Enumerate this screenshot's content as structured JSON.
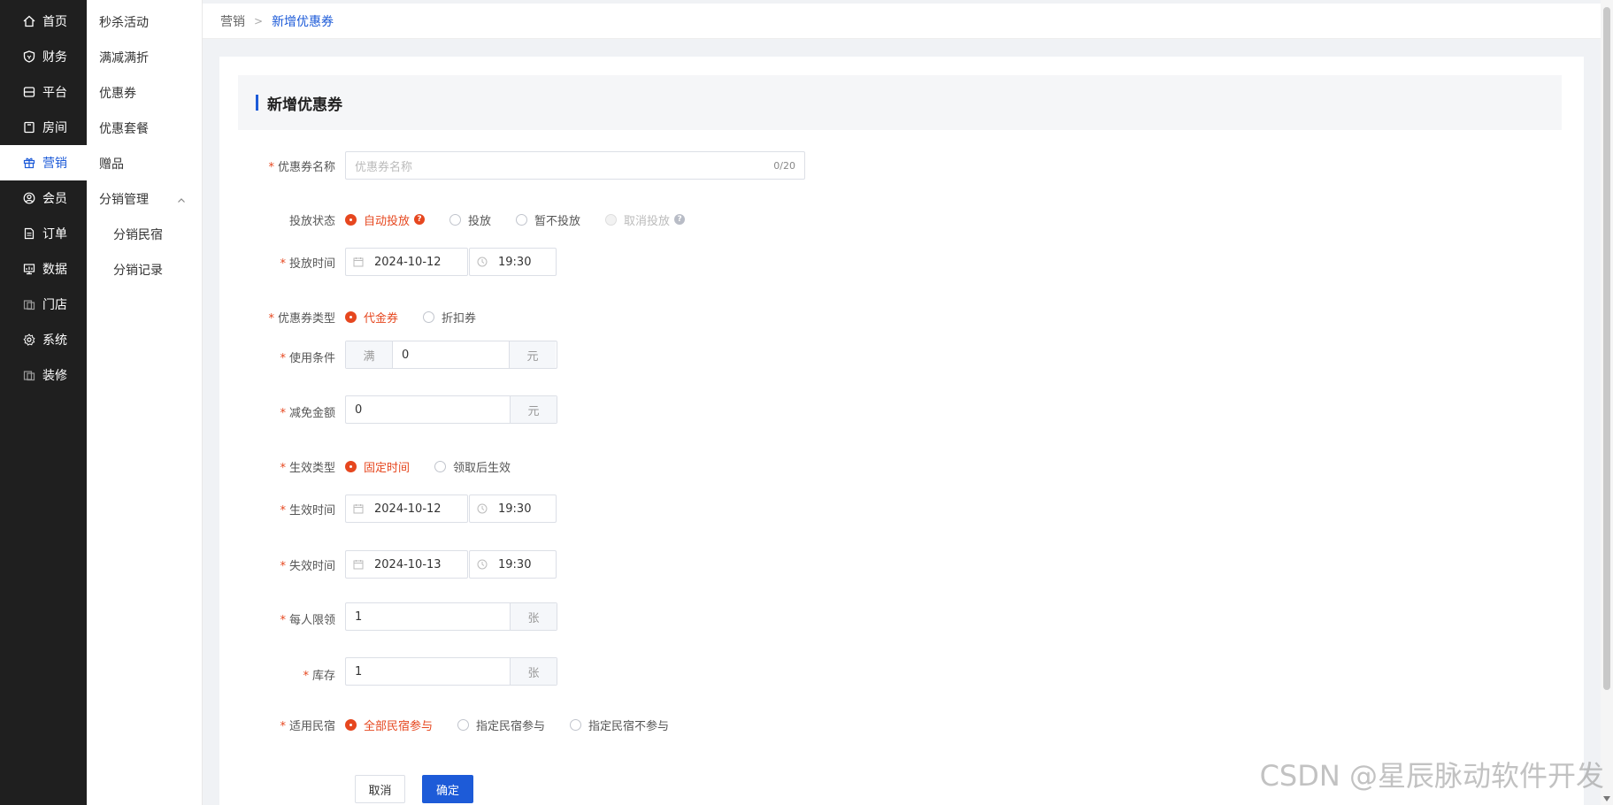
{
  "nav": {
    "items": [
      {
        "label": "首页",
        "icon": "home-icon"
      },
      {
        "label": "财务",
        "icon": "shield-icon"
      },
      {
        "label": "平台",
        "icon": "platform-icon"
      },
      {
        "label": "房间",
        "icon": "room-icon"
      },
      {
        "label": "营销",
        "icon": "gift-icon"
      },
      {
        "label": "会员",
        "icon": "user-icon"
      },
      {
        "label": "订单",
        "icon": "order-icon"
      },
      {
        "label": "数据",
        "icon": "chart-icon"
      },
      {
        "label": "门店",
        "icon": "store-icon"
      },
      {
        "label": "系统",
        "icon": "gear-icon"
      },
      {
        "label": "装修",
        "icon": "decor-icon"
      }
    ],
    "active_index": 4
  },
  "submenu": {
    "items": [
      {
        "label": "秒杀活动"
      },
      {
        "label": "满减满折"
      },
      {
        "label": "优惠券"
      },
      {
        "label": "优惠套餐"
      },
      {
        "label": "赠品"
      },
      {
        "label": "分销管理"
      },
      {
        "label": "分销民宿"
      },
      {
        "label": "分销记录"
      }
    ]
  },
  "breadcrumb": {
    "parent": "营销",
    "current": "新增优惠券"
  },
  "card": {
    "title": "新增优惠券"
  },
  "form": {
    "name": {
      "label": "优惠券名称",
      "placeholder": "优惠券名称",
      "counter": "0/20"
    },
    "status": {
      "label": "投放状态",
      "options": [
        "自动投放",
        "投放",
        "暂不投放",
        "取消投放"
      ]
    },
    "release_time": {
      "label": "投放时间",
      "date": "2024-10-12",
      "time": "19:30"
    },
    "type": {
      "label": "优惠券类型",
      "options": [
        "代金券",
        "折扣券"
      ]
    },
    "condition": {
      "label": "使用条件",
      "prefix": "满",
      "value": "0",
      "suffix": "元"
    },
    "discount": {
      "label": "减免金额",
      "value": "0",
      "suffix": "元"
    },
    "effect_type": {
      "label": "生效类型",
      "options": [
        "固定时间",
        "领取后生效"
      ]
    },
    "effect_time": {
      "label": "生效时间",
      "date": "2024-10-12",
      "time": "19:30"
    },
    "expire_time": {
      "label": "失效时间",
      "date": "2024-10-13",
      "time": "19:30"
    },
    "limit": {
      "label": "每人限领",
      "value": "1",
      "suffix": "张"
    },
    "stock": {
      "label": "库存",
      "value": "1",
      "suffix": "张"
    },
    "homestay": {
      "label": "适用民宿",
      "options": [
        "全部民宿参与",
        "指定民宿参与",
        "指定民宿不参与"
      ]
    }
  },
  "buttons": {
    "cancel": "取消",
    "confirm": "确定"
  },
  "watermark": "CSDN @星辰脉动软件开发",
  "colors": {
    "accent": "#1d5bd8",
    "radio_checked": "#e6471f",
    "nav_bg": "#1f1f1f"
  }
}
